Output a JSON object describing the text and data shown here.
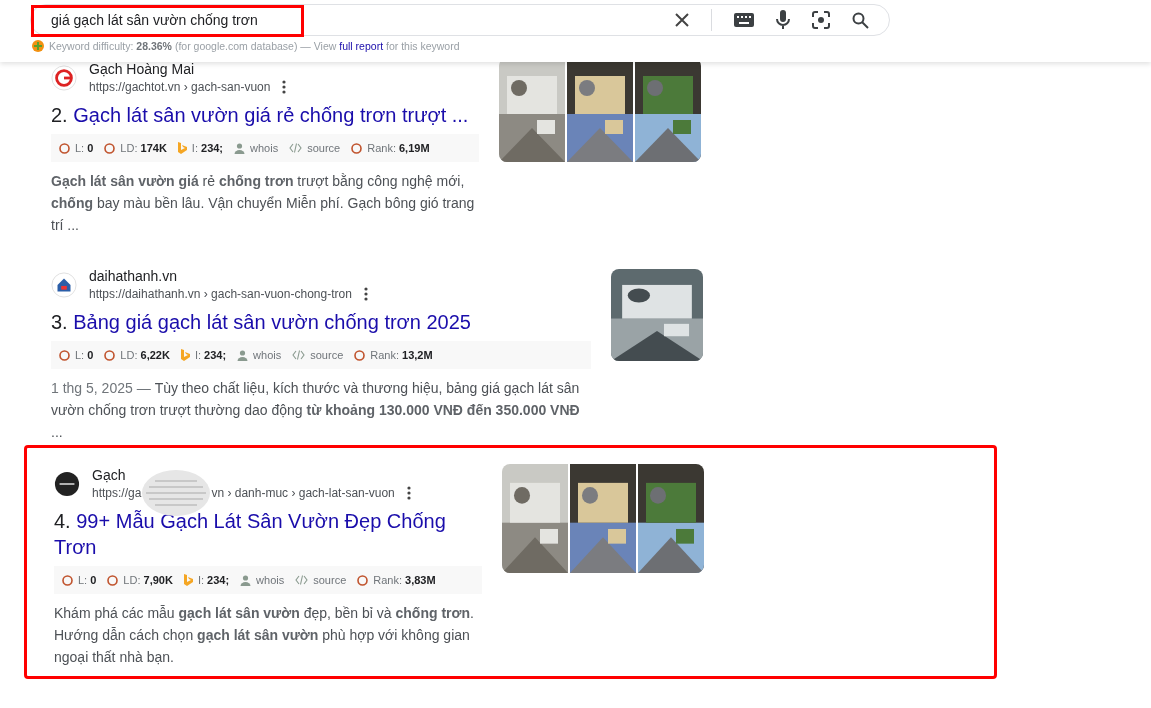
{
  "search": {
    "value": "giá gạch lát sân vườn chống trơn"
  },
  "keyword_bar": {
    "label": "Keyword difficulty:",
    "value": "28.36%",
    "note": "(for google.com database) — View",
    "link": "full report",
    "suffix": "for this keyword"
  },
  "results": [
    {
      "site": "Gạch Hoàng Mai",
      "url": "https://gachtot.vn › gach-san-vuon",
      "number": "2.",
      "title": "Gạch lát sân vườn giá rẻ chống trơn trượt ...",
      "highlighted": false,
      "metrics": [
        {
          "kind": "circle",
          "label": "L:",
          "value": "0"
        },
        {
          "kind": "circle",
          "label": "LD:",
          "value": "174K"
        },
        {
          "kind": "bing",
          "label": "I:",
          "value": "234;"
        },
        {
          "kind": "whois",
          "label": "whois"
        },
        {
          "kind": "source",
          "label": "source"
        },
        {
          "kind": "circle",
          "label": "Rank:",
          "value": "6,19M"
        }
      ],
      "snippet": "**Gạch lát sân vườn giá** rẻ **chống trơn** trượt bằng công nghệ mới, **chống** bay màu bền lâu. Vận chuyển Miễn phí. Gạch bông gió trang trí ..."
    },
    {
      "site": "daihathanh.vn",
      "url": "https://daihathanh.vn › gach-san-vuon-chong-tron",
      "number": "3.",
      "title": "Bảng giá gạch lát sân vườn chống trơn 2025",
      "highlighted": false,
      "metrics": [
        {
          "kind": "circle",
          "label": "L:",
          "value": "0"
        },
        {
          "kind": "circle",
          "label": "LD:",
          "value": "6,22K"
        },
        {
          "kind": "bing",
          "label": "I:",
          "value": "234;"
        },
        {
          "kind": "whois",
          "label": "whois"
        },
        {
          "kind": "source",
          "label": "source"
        },
        {
          "kind": "circle",
          "label": "Rank:",
          "value": "13,2M"
        }
      ],
      "date": "1 thg 5, 2025 —",
      "snippet": "Tùy theo chất liệu, kích thước và thương hiệu, bảng giá gạch lát sân vườn chống trơn trượt thường dao động **từ khoảng 130.000 VNĐ đến 350.000 VNĐ** ..."
    },
    {
      "site": "Gạch",
      "url": "https://ga",
      "url_end": "vn › danh-muc › gach-lat-san-vuon",
      "redacted": true,
      "number": "4.",
      "title": "99+ Mẫu Gạch Lát Sân Vườn Đẹp Chống Trơn",
      "highlighted": true,
      "metrics": [
        {
          "kind": "circle",
          "label": "L:",
          "value": "0"
        },
        {
          "kind": "circle",
          "label": "LD:",
          "value": "7,90K"
        },
        {
          "kind": "bing",
          "label": "I:",
          "value": "234;"
        },
        {
          "kind": "whois",
          "label": "whois"
        },
        {
          "kind": "source",
          "label": "source"
        },
        {
          "kind": "circle",
          "label": "Rank:",
          "value": "3,83M"
        }
      ],
      "snippet": "Khám phá các mẫu **gạch lát sân vườn** đẹp, bền bỉ và **chống trơn**. Hướng dẫn cách chọn **gạch lát sân vườn** phù hợp với không gian ngoại thất nhà bạn."
    }
  ]
}
